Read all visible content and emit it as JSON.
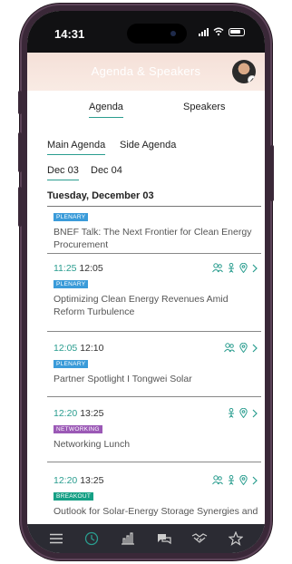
{
  "status_bar": {
    "time": "14:31"
  },
  "header": {
    "title": "Agenda & Speakers"
  },
  "top_tabs": [
    {
      "label": "Agenda",
      "active": true
    },
    {
      "label": "Speakers",
      "active": false
    }
  ],
  "sub_tabs": [
    {
      "label": "Main Agenda",
      "active": true
    },
    {
      "label": "Side Agenda",
      "active": false
    }
  ],
  "date_tabs": [
    {
      "label": "Dec 03",
      "active": true
    },
    {
      "label": "Dec 04",
      "active": false
    }
  ],
  "day_header": "Tuesday, December 03",
  "sessions": [
    {
      "start": "",
      "end": "",
      "tag": "PLENARY",
      "title": "BNEF Talk: The Next Frontier for Clean Energy Procurement",
      "icons": []
    },
    {
      "start": "11:25",
      "end": "12:05",
      "tag": "PLENARY",
      "title": "Optimizing Clean Energy Revenues Amid Reform Turbulence",
      "icons": [
        "speakers-icon",
        "person-icon",
        "location-icon",
        "chevron-right-icon"
      ]
    },
    {
      "start": "12:05",
      "end": "12:10",
      "tag": "PLENARY",
      "title": "Partner Spotlight I Tongwei Solar",
      "icons": [
        "speakers-icon",
        "location-icon",
        "chevron-right-icon"
      ]
    },
    {
      "start": "12:20",
      "end": "13:25",
      "tag": "NETWORKING",
      "title": "Networking Lunch",
      "icons": [
        "person-icon",
        "location-icon",
        "chevron-right-icon"
      ]
    },
    {
      "start": "12:20",
      "end": "13:25",
      "tag": "BREAKOUT",
      "title": "Outlook for Solar-Energy Storage Synergies and",
      "icons": [
        "speakers-icon",
        "person-icon",
        "location-icon",
        "chevron-right-icon"
      ]
    }
  ],
  "bottom_nav": [
    "menu-icon",
    "clock-icon",
    "chart-icon",
    "chat-icon",
    "handshake-icon",
    "star-icon"
  ],
  "colors": {
    "accent": "#2a9d8f",
    "plenary": "#3a9bd9",
    "networking": "#9b59b6",
    "breakout": "#16a085",
    "nav_bg": "#2b2b33"
  }
}
